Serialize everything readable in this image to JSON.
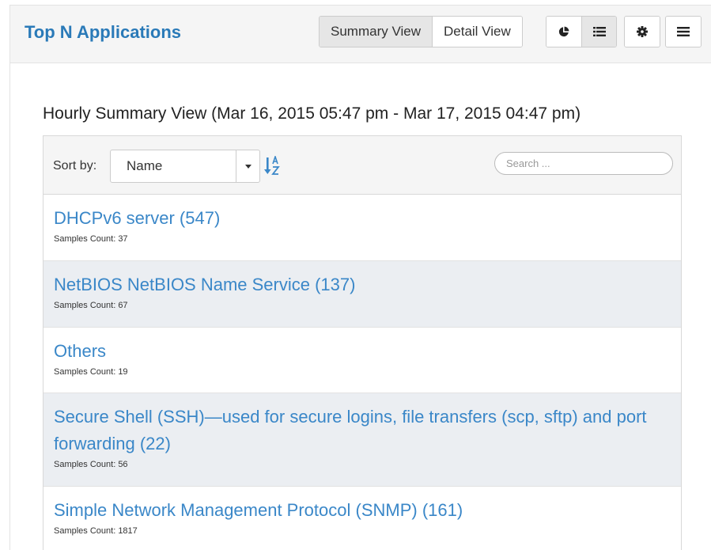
{
  "header": {
    "title": "Top N Applications",
    "views": [
      {
        "label": "Summary View",
        "active": true
      },
      {
        "label": "Detail View",
        "active": false
      }
    ],
    "icons": {
      "chart": "pie-chart-icon",
      "list": "list-icon",
      "settings": "gear-icon",
      "menu": "menu-icon"
    }
  },
  "summary": {
    "heading": "Hourly Summary View (Mar 16, 2015 05:47 pm - Mar 17, 2015 04:47 pm)"
  },
  "toolbar": {
    "sort_label": "Sort by:",
    "sort_value": "Name",
    "search_placeholder": "Search ..."
  },
  "items": [
    {
      "title": "DHCPv6 server (547)",
      "subtitle": "Samples Count: 37"
    },
    {
      "title": "NetBIOS NetBIOS Name Service (137)",
      "subtitle": "Samples Count: 67"
    },
    {
      "title": "Others",
      "subtitle": "Samples Count: 19"
    },
    {
      "title": "Secure Shell (SSH)—used for secure logins, file transfers (scp, sftp) and port forwarding (22)",
      "subtitle": "Samples Count: 56"
    },
    {
      "title": "Simple Network Management Protocol (SNMP) (161)",
      "subtitle": "Samples Count: 1817"
    }
  ],
  "colors": {
    "accent": "#2a7ab8",
    "link": "#3a87c8",
    "alt_row": "#ebeef2"
  }
}
